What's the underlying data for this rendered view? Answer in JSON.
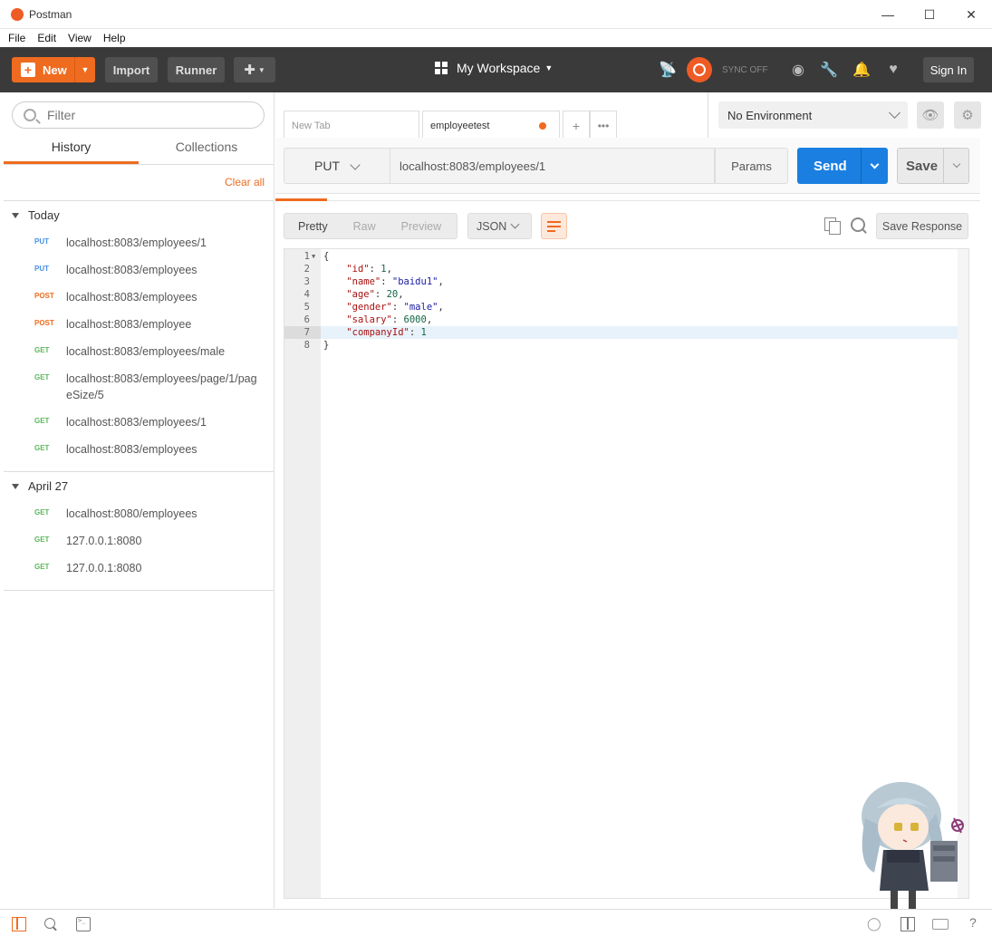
{
  "window": {
    "title": "Postman",
    "controls": [
      "minimize",
      "maximize",
      "close"
    ]
  },
  "menu": [
    "File",
    "Edit",
    "View",
    "Help"
  ],
  "header": {
    "new_label": "New",
    "import_label": "Import",
    "runner_label": "Runner",
    "workspace_label": "My Workspace",
    "sync_label": "SYNC OFF",
    "signin_label": "Sign In"
  },
  "sidebar": {
    "filter_placeholder": "Filter",
    "tabs": [
      {
        "label": "History",
        "active": true
      },
      {
        "label": "Collections",
        "active": false
      }
    ],
    "clear_all": "Clear all",
    "groups": [
      {
        "label": "Today",
        "items": [
          {
            "method": "PUT",
            "url": "localhost:8083/employees/1"
          },
          {
            "method": "PUT",
            "url": "localhost:8083/employees"
          },
          {
            "method": "POST",
            "url": "localhost:8083/employees"
          },
          {
            "method": "POST",
            "url": "localhost:8083/employee"
          },
          {
            "method": "GET",
            "url": "localhost:8083/employees/male"
          },
          {
            "method": "GET",
            "url": "localhost:8083/employees/page/1/pageSize/5"
          },
          {
            "method": "GET",
            "url": "localhost:8083/employees/1"
          },
          {
            "method": "GET",
            "url": "localhost:8083/employees"
          }
        ]
      },
      {
        "label": "April 27",
        "items": [
          {
            "method": "GET",
            "url": "localhost:8080/employees"
          },
          {
            "method": "GET",
            "url": "127.0.0.1:8080"
          },
          {
            "method": "GET",
            "url": "127.0.0.1:8080"
          }
        ]
      }
    ]
  },
  "tabs": [
    {
      "label": "New Tab",
      "active": false
    },
    {
      "label": "employeetest",
      "active": true,
      "unsaved": true
    }
  ],
  "environment": {
    "selected": "No Environment"
  },
  "request": {
    "method": "PUT",
    "url": "localhost:8083/employees/1",
    "params_label": "Params",
    "send_label": "Send",
    "save_label": "Save"
  },
  "response": {
    "view_tabs": [
      {
        "label": "Pretty",
        "active": true
      },
      {
        "label": "Raw",
        "active": false
      },
      {
        "label": "Preview",
        "active": false
      }
    ],
    "format": "JSON",
    "save_response_label": "Save Response",
    "lines": [
      {
        "n": "1",
        "text": "{"
      },
      {
        "n": "2",
        "key": "\"id\"",
        "value": "1",
        "type": "num",
        "comma": true
      },
      {
        "n": "3",
        "key": "\"name\"",
        "value": "\"baidu1\"",
        "type": "str",
        "comma": true
      },
      {
        "n": "4",
        "key": "\"age\"",
        "value": "20",
        "type": "num",
        "comma": true
      },
      {
        "n": "5",
        "key": "\"gender\"",
        "value": "\"male\"",
        "type": "str",
        "comma": true
      },
      {
        "n": "6",
        "key": "\"salary\"",
        "value": "6000",
        "type": "num",
        "comma": true
      },
      {
        "n": "7",
        "key": "\"companyId\"",
        "value": "1",
        "type": "num",
        "comma": false
      },
      {
        "n": "8",
        "text": "}"
      }
    ],
    "highlight_line": 7
  }
}
